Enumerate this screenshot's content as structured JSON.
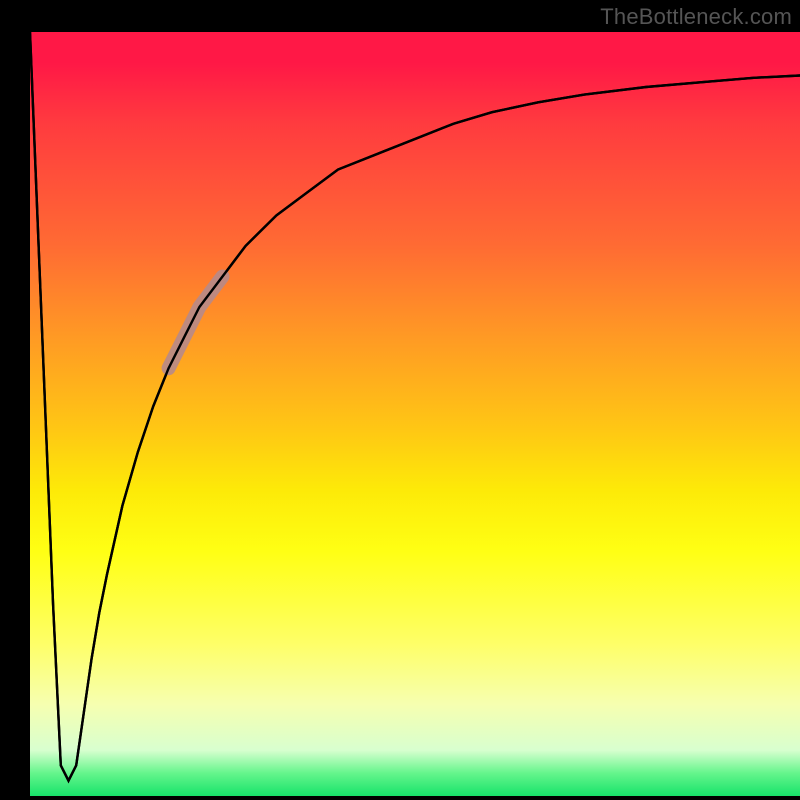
{
  "watermark": "TheBottleneck.com",
  "chart_data": {
    "type": "line",
    "title": "",
    "xlabel": "",
    "ylabel": "",
    "xlim": [
      0,
      100
    ],
    "ylim": [
      0,
      100
    ],
    "grid": false,
    "series": [
      {
        "name": "curve",
        "x": [
          0,
          2,
          3,
          4,
          5,
          6,
          7,
          8,
          9,
          10,
          12,
          14,
          16,
          18,
          20,
          22,
          25,
          28,
          32,
          36,
          40,
          45,
          50,
          55,
          60,
          66,
          72,
          80,
          88,
          94,
          100
        ],
        "values": [
          100,
          50,
          25,
          4,
          2,
          4,
          11,
          18,
          24,
          29,
          38,
          45,
          51,
          56,
          60,
          64,
          68,
          72,
          76,
          79,
          82,
          84,
          86,
          88,
          89.5,
          90.8,
          91.8,
          92.8,
          93.5,
          94.0,
          94.3
        ]
      }
    ],
    "highlight_segment": {
      "x_start": 18,
      "x_end": 26
    },
    "gradient_stops": [
      {
        "pos": 0,
        "color": "#ff1846"
      },
      {
        "pos": 20,
        "color": "#ff6b33"
      },
      {
        "pos": 40,
        "color": "#ffc714"
      },
      {
        "pos": 60,
        "color": "#ffff14"
      },
      {
        "pos": 80,
        "color": "#f6ffb0"
      },
      {
        "pos": 100,
        "color": "#17e36a"
      }
    ]
  }
}
